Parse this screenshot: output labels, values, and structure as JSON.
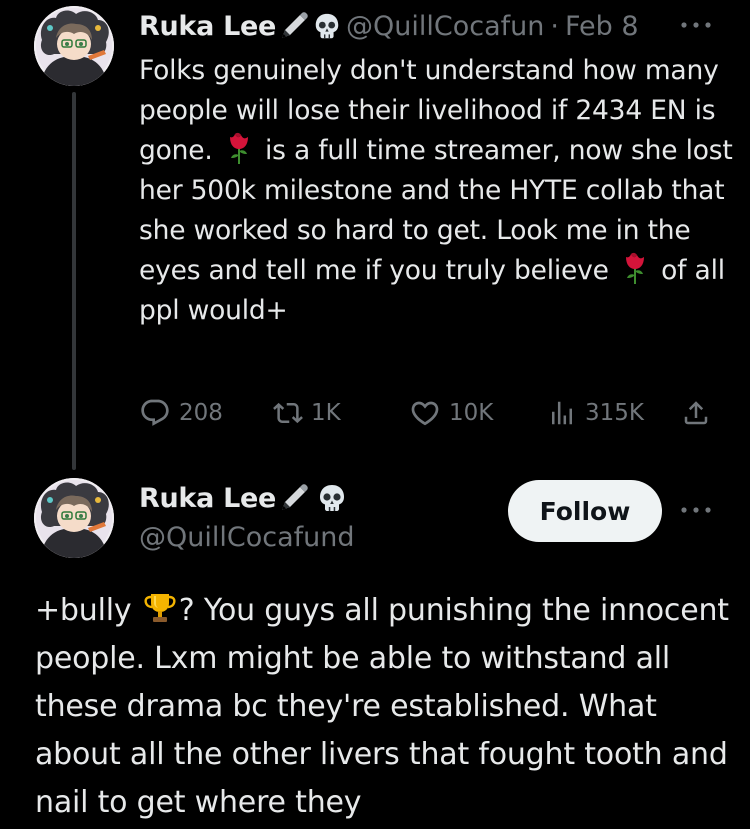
{
  "colors": {
    "background": "#000000",
    "text_primary": "#e7e9ea",
    "text_secondary": "#71767b",
    "follow_bg": "#eff3f4"
  },
  "tweet1": {
    "author_name": "Ruka Lee",
    "name_emojis": [
      "pen-icon",
      "skull-icon"
    ],
    "handle": "@QuillCocafun",
    "separator": "·",
    "date": "Feb 8",
    "text_parts": [
      "Folks genuinely don't understand how many people will lose their livelihood if 2434 EN is gone. ",
      " is a full time streamer, now she lost her 500k milestone and the HYTE collab that she worked so hard to get. Look me in the eyes and tell me if you truly believe ",
      " of all ppl would+"
    ],
    "actions": {
      "replies": "208",
      "retweets": "1K",
      "likes": "10K",
      "views": "315K"
    }
  },
  "tweet2": {
    "author_name": "Ruka Lee",
    "name_emojis": [
      "pen-icon",
      "skull-icon"
    ],
    "handle": "@QuillCocafund",
    "follow_label": "Follow",
    "text_parts": [
      "+bully ",
      "? You guys all punishing the innocent people. Lxm might be able to withstand all these drama bc they're established. What about all the other livers that fought tooth and nail to get where they"
    ]
  }
}
